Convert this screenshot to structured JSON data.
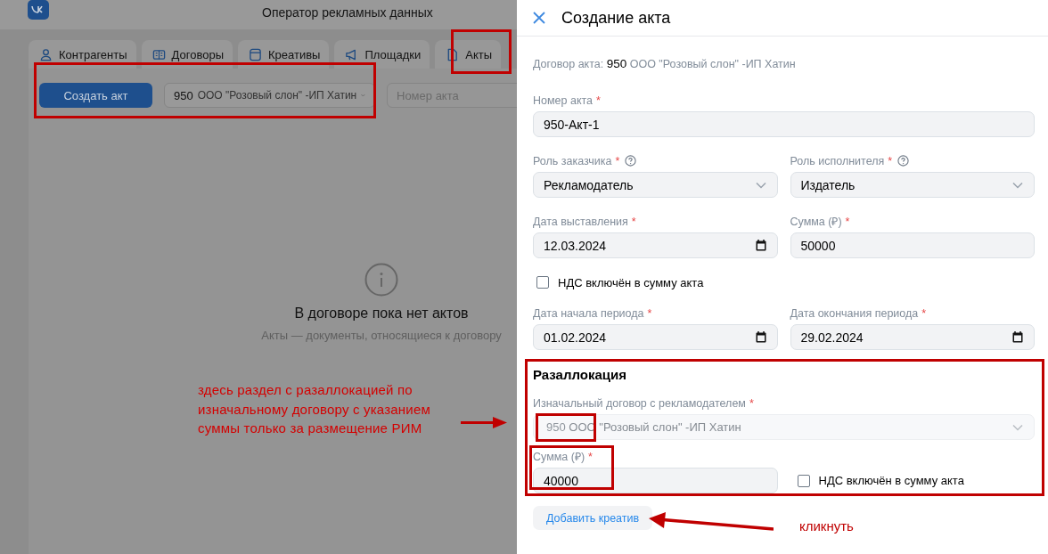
{
  "app": {
    "title": "Оператор рекламных данных",
    "tabs": [
      {
        "label": "Контрагенты",
        "kind": "person"
      },
      {
        "label": "Договоры",
        "kind": "book"
      },
      {
        "label": "Креативы",
        "kind": "window"
      },
      {
        "label": "Площадки",
        "kind": "megaphone"
      },
      {
        "label": "Акты",
        "kind": "document"
      }
    ],
    "create_button": "Создать акт",
    "contract_select": {
      "number": "950",
      "name": "ООО \"Розовый слон\" -ИП Хатин"
    },
    "search": {
      "placeholder": "Номер акта"
    },
    "empty_state": {
      "title": "В договоре пока нет актов",
      "subtitle": "Акты — документы, относящиеся к договору"
    }
  },
  "drawer": {
    "title": "Создание акта",
    "contract": {
      "label": "Договор акта:",
      "number": "950",
      "name": "ООО \"Розовый слон\" -ИП Хатин"
    },
    "rows": [
      [
        {
          "kind": "text",
          "label": "Номер акта",
          "asterisk": "*",
          "value": "950-Акт-1"
        }
      ],
      [
        {
          "kind": "select",
          "label": "Роль заказчика",
          "asterisk": "*",
          "help": true,
          "value": "Рекламодатель"
        },
        {
          "kind": "select",
          "label": "Роль исполнителя",
          "asterisk": "*",
          "help": true,
          "value": "Издатель"
        }
      ],
      [
        {
          "kind": "date",
          "label": "Дата выставления",
          "asterisk": "*",
          "value": "12.03.2024"
        },
        {
          "kind": "text",
          "label": "Сумма (₽)",
          "asterisk": "*",
          "value": "50000"
        }
      ],
      [
        {
          "kind": "checkbox",
          "label": "НДС включён в сумму акта",
          "checked": false
        }
      ],
      [
        {
          "kind": "date",
          "label": "Дата начала периода",
          "asterisk": "*",
          "value": "01.02.2024"
        },
        {
          "kind": "date",
          "label": "Дата окончания периода",
          "asterisk": "*",
          "value": "29.02.2024"
        }
      ]
    ],
    "section": {
      "title": "Разаллокация",
      "rows": [
        [
          {
            "kind": "select",
            "label": "Изначальный договор с рекламодателем",
            "asterisk": "*",
            "disabled": true,
            "number": "950",
            "value": "ООО \"Розовый слон\" -ИП Хатин"
          }
        ],
        [
          {
            "kind": "text",
            "label": "Сумма (₽)",
            "asterisk": "*",
            "disabled": false,
            "value": "40000"
          },
          {
            "kind": "checkbox",
            "label": "НДС включён в сумму акта",
            "checked": false,
            "disabled": false
          }
        ]
      ]
    },
    "add_button": "Добавить креатив"
  },
  "annotations": {
    "note": [
      "здесь раздел с разаллокацией по",
      "изначальному договору с указанием",
      "суммы только за размещение РИМ"
    ],
    "click_note": "кликнуть"
  }
}
